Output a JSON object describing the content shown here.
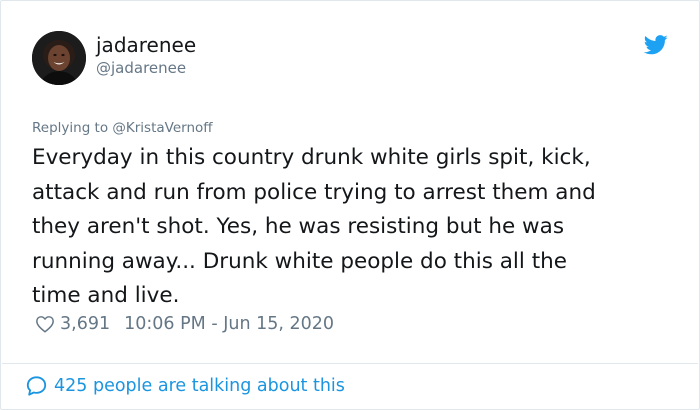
{
  "user": {
    "display_name": "jadarenee",
    "handle": "@jadarenee"
  },
  "tweet": {
    "reply_prefix": "Replying to ",
    "reply_to": "@KristaVernoff",
    "text": "Everyday in this country drunk white girls spit, kick,\nattack and run from police trying to arrest  them and\nthey aren't shot. Yes, he was resisting but he was\nrunning away... Drunk white people do this all the\ntime and live.",
    "likes": "3,691",
    "timestamp": "10:06 PM - Jun 15, 2020"
  },
  "footer": {
    "talking_text": "425 people are talking about this"
  },
  "icons": {
    "brand": "twitter-bird-icon",
    "like": "heart-outline-icon",
    "replies": "speech-bubble-icon"
  },
  "colors": {
    "brand_blue": "#1da1f2",
    "link_blue": "#1b95e0",
    "secondary_text": "#657786",
    "primary_text": "#14171a",
    "border": "#e1e8ed"
  }
}
